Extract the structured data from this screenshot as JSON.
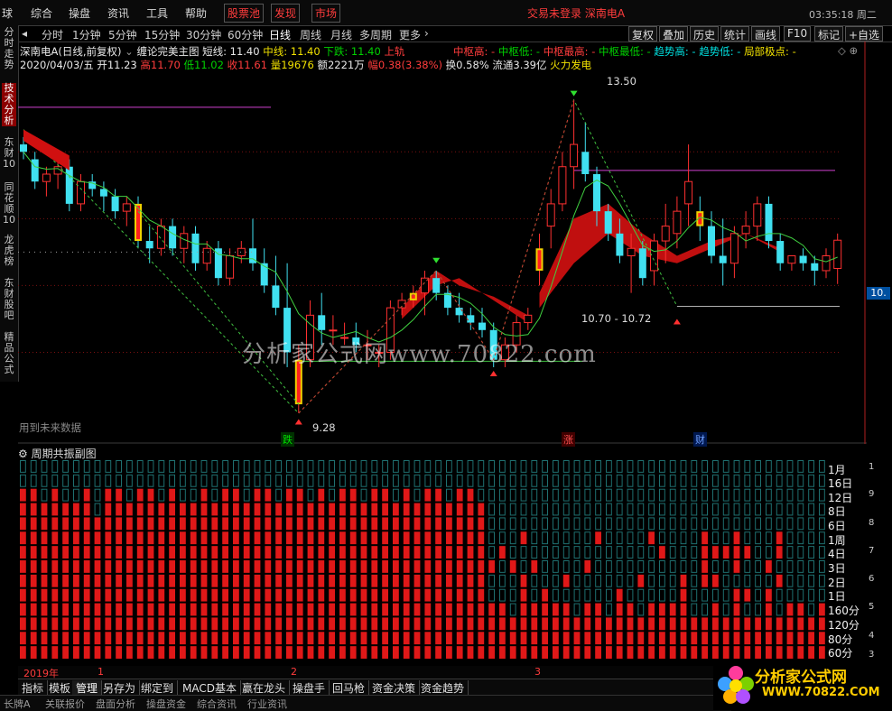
{
  "menu": {
    "items": [
      "球",
      "综合",
      "操盘",
      "资讯",
      "工具",
      "帮助"
    ],
    "red_items": [
      "股票池",
      "发现",
      "市场"
    ],
    "status": "交易未登录  深南电A",
    "clock": "03:35:18 周二"
  },
  "sidebar": {
    "items": [
      "分时走势",
      "技术分析",
      "东财10",
      "同花顺10",
      "龙虎榜",
      "东财股吧",
      "精品公式"
    ],
    "active_index": 1
  },
  "periods": {
    "items": [
      "分时",
      "1分钟",
      "5分钟",
      "15分钟",
      "30分钟",
      "60分钟",
      "日线",
      "周线",
      "月线",
      "多周期",
      "更多"
    ],
    "active": "日线",
    "right_buttons": [
      "复权",
      "叠加",
      "历史",
      "统计",
      "画线",
      "F10",
      "标记",
      "+自选"
    ]
  },
  "info": {
    "stock": "深南电A(日线,前复权)",
    "indicator": "缠论完美主图",
    "short_line": "短线: 11.40",
    "mid_line": "中线: 11.40",
    "down": "下跌: 11.40",
    "up_rail": "上轨",
    "zs_high": "中枢高: -",
    "zs_low": "中枢低: -",
    "zs_top": "中枢最高: -",
    "zs_bottom": "中枢最低: -",
    "trend_high": "趋势高: -",
    "trend_low": "趋势低: -",
    "local_extreme": "局部极点: -",
    "date": "2020/04/03/五",
    "open": "开11.23",
    "high": "高11.70",
    "low": "低11.02",
    "close": "收11.61",
    "volume": "量19676",
    "amount": "额2221万",
    "amplitude": "幅0.38(3.38%)",
    "turnover": "换0.58%",
    "float": "流通3.39亿",
    "concept": "火力发电"
  },
  "chart": {
    "annotations": {
      "peak": "13.50",
      "trough": "9.28",
      "zone": "10.70 - 10.72",
      "axis_value": "10."
    },
    "signals": [
      "跌",
      "涨",
      "财"
    ],
    "future_label": "用到未来数据",
    "watermark": "分析家公式网www.70822.com"
  },
  "chart_data": {
    "type": "candlestick",
    "ohlc": [
      [
        12.9,
        13.0,
        12.7,
        12.8
      ],
      [
        12.7,
        12.8,
        12.3,
        12.4
      ],
      [
        12.4,
        12.6,
        12.2,
        12.5
      ],
      [
        12.5,
        12.8,
        12.3,
        12.6
      ],
      [
        12.6,
        12.7,
        12.0,
        12.1
      ],
      [
        12.1,
        12.5,
        12.0,
        12.4
      ],
      [
        12.4,
        12.5,
        12.2,
        12.3
      ],
      [
        12.3,
        12.4,
        12.0,
        12.2
      ],
      [
        12.2,
        12.3,
        11.9,
        12.0
      ],
      [
        12.0,
        12.2,
        11.8,
        12.1
      ],
      [
        12.1,
        12.2,
        11.5,
        11.6
      ],
      [
        11.6,
        11.8,
        11.3,
        11.5
      ],
      [
        11.5,
        11.9,
        11.4,
        11.8
      ],
      [
        11.8,
        11.9,
        11.4,
        11.5
      ],
      [
        11.5,
        11.8,
        11.3,
        11.7
      ],
      [
        11.7,
        11.8,
        11.2,
        11.3
      ],
      [
        11.3,
        11.6,
        11.2,
        11.5
      ],
      [
        11.5,
        11.6,
        11.0,
        11.1
      ],
      [
        11.1,
        11.5,
        11.0,
        11.4
      ],
      [
        11.4,
        11.6,
        11.3,
        11.5
      ],
      [
        11.5,
        11.9,
        11.2,
        11.3
      ],
      [
        11.3,
        11.5,
        10.9,
        11.0
      ],
      [
        11.0,
        11.4,
        10.6,
        10.7
      ],
      [
        10.7,
        11.3,
        9.9,
        10.1
      ],
      [
        9.4,
        10.2,
        9.28,
        10.0
      ],
      [
        10.0,
        10.8,
        9.9,
        10.6
      ],
      [
        10.6,
        10.9,
        10.2,
        10.4
      ],
      [
        10.4,
        10.6,
        10.2,
        10.4
      ],
      [
        10.3,
        10.5,
        10.2,
        10.3
      ],
      [
        10.3,
        10.5,
        10.1,
        10.2
      ],
      [
        10.2,
        10.4,
        10.0,
        10.2
      ],
      [
        10.1,
        10.2,
        9.9,
        10.1
      ],
      [
        10.1,
        10.8,
        10.0,
        10.7
      ],
      [
        10.7,
        10.9,
        10.6,
        10.8
      ],
      [
        10.8,
        11.0,
        10.7,
        10.9
      ],
      [
        10.9,
        11.2,
        10.6,
        11.1
      ],
      [
        11.1,
        11.2,
        10.8,
        10.9
      ],
      [
        10.9,
        11.0,
        10.6,
        10.7
      ],
      [
        10.7,
        10.9,
        10.5,
        10.6
      ],
      [
        10.6,
        10.7,
        10.4,
        10.5
      ],
      [
        10.5,
        10.7,
        10.3,
        10.4
      ],
      [
        10.4,
        10.5,
        9.9,
        10.0
      ],
      [
        10.0,
        10.3,
        9.9,
        10.2
      ],
      [
        10.2,
        10.6,
        10.1,
        10.5
      ],
      [
        10.5,
        10.7,
        10.4,
        10.6
      ],
      [
        11.2,
        11.7,
        11.0,
        11.5
      ],
      [
        11.8,
        12.3,
        11.5,
        12.1
      ],
      [
        12.1,
        12.8,
        12.0,
        12.6
      ],
      [
        12.6,
        13.5,
        12.3,
        12.9
      ],
      [
        12.8,
        13.2,
        12.4,
        12.5
      ],
      [
        12.5,
        12.6,
        11.8,
        12.0
      ],
      [
        12.0,
        12.1,
        11.6,
        11.7
      ],
      [
        11.7,
        11.9,
        11.3,
        11.4
      ],
      [
        11.4,
        11.7,
        10.9,
        11.5
      ],
      [
        11.5,
        11.6,
        11.0,
        11.1
      ],
      [
        11.2,
        11.7,
        11.0,
        11.6
      ],
      [
        11.6,
        12.1,
        11.3,
        11.8
      ],
      [
        11.7,
        12.2,
        11.5,
        12.0
      ],
      [
        12.1,
        12.9,
        11.8,
        12.4
      ],
      [
        12.0,
        12.2,
        11.6,
        11.8
      ],
      [
        11.8,
        12.0,
        11.3,
        11.4
      ],
      [
        11.4,
        11.9,
        11.0,
        11.3
      ],
      [
        11.3,
        11.8,
        11.1,
        11.7
      ],
      [
        11.7,
        12.0,
        11.5,
        11.8
      ],
      [
        11.8,
        12.2,
        11.6,
        12.1
      ],
      [
        12.1,
        12.2,
        11.5,
        11.6
      ],
      [
        11.6,
        11.7,
        11.2,
        11.3
      ],
      [
        11.3,
        11.4,
        11.2,
        11.4
      ],
      [
        11.4,
        11.5,
        11.2,
        11.3
      ],
      [
        11.3,
        11.4,
        11.0,
        11.2
      ],
      [
        11.2,
        11.5,
        11.1,
        11.4
      ],
      [
        11.23,
        11.7,
        11.02,
        11.61
      ]
    ],
    "highlight_yellow_bars": [
      10,
      24,
      34,
      45,
      59
    ],
    "ylim": [
      9.0,
      13.8
    ],
    "x_labels": [
      "2019年",
      "1",
      "2",
      "3"
    ],
    "sub_rows": [
      "1月",
      "16日",
      "12日",
      "8日",
      "6日",
      "1周",
      "4日",
      "3日",
      "2日",
      "1日",
      "160分",
      "120分",
      "80分",
      "60分"
    ],
    "sub_axis": [
      "1",
      "9",
      "8",
      "7",
      "6",
      "5",
      "4",
      "3"
    ],
    "sub_levels": [
      12,
      12,
      11,
      12,
      11,
      11,
      12,
      10,
      12,
      12,
      11,
      12,
      12,
      11,
      12,
      11,
      11,
      12,
      11,
      12,
      12,
      11,
      12,
      12,
      11,
      12,
      12,
      11,
      12,
      11,
      12,
      12,
      11,
      12,
      12,
      11,
      12,
      11,
      12,
      12,
      11,
      12,
      12,
      11,
      4,
      3,
      3,
      4,
      3,
      4,
      3,
      4,
      3,
      3,
      4,
      3,
      3,
      4,
      3,
      4,
      3,
      3,
      4,
      3,
      3,
      4,
      3,
      4,
      3,
      3,
      4,
      3,
      3,
      4,
      3,
      4
    ]
  },
  "sub_panel": {
    "title": "周期共振副图"
  },
  "timeline": {
    "labels": [
      "2019年",
      "1",
      "2",
      "3"
    ]
  },
  "tabs": {
    "items": [
      "指标",
      "模板",
      "管理",
      "另存为",
      "绑定到",
      "MACD基本",
      "赢在龙头",
      "操盘手",
      "回马枪",
      "资金决策",
      "资金趋势"
    ],
    "active": "管理",
    "row2": [
      "长牌A",
      "关联报价",
      "盘面分析",
      "操盘资金",
      "综合资讯",
      "行业资讯"
    ]
  },
  "logo": {
    "text": "分析家公式网",
    "url": "WWW.70822.COM"
  }
}
